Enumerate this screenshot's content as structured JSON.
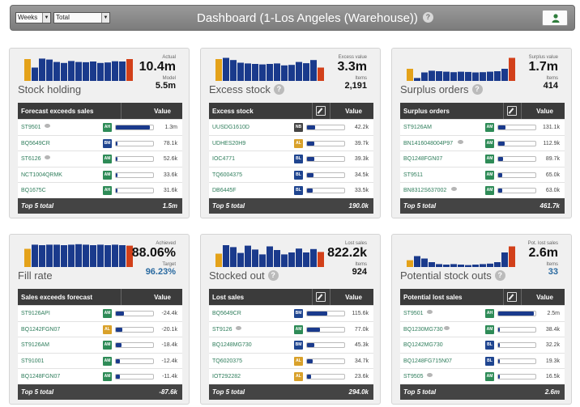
{
  "header": {
    "period_select": "Weeks",
    "scope_select": "Total",
    "title": "Dashboard (1-Los Angeles (Warehouse))",
    "help_icon": "question-icon",
    "user_icon": "user-icon"
  },
  "colors": {
    "bar_blue": "#1a3a8c",
    "bar_orange": "#e4a21a",
    "bar_red": "#d2401a",
    "badge_green": "#2e8b57",
    "badge_blue": "#1f4590",
    "badge_orange": "#d9a12a",
    "badge_dark": "#444444"
  },
  "panels": [
    {
      "id": "stock-holding",
      "name": "Stock holding",
      "has_help": false,
      "kpi_label": "Actual",
      "kpi_value": "10.4m",
      "sub_label": "Model",
      "sub_value": "5.5m",
      "sub_blue": false,
      "show_edit": false,
      "spark": {
        "orange": 0.9,
        "red": 0.9,
        "blue": [
          0.55,
          0.92,
          0.88,
          0.78,
          0.74,
          0.82,
          0.78,
          0.77,
          0.8,
          0.74,
          0.76,
          0.81,
          0.8
        ]
      },
      "table": {
        "col1": "Forecast exceeds sales",
        "col2": "Value",
        "rows": [
          {
            "name": "ST9501",
            "comment": true,
            "badge": "AH",
            "color": "green",
            "fill": 0.92,
            "value": "1.3m"
          },
          {
            "name": "BQ5649CR",
            "comment": false,
            "badge": "BM",
            "color": "blue",
            "fill": 0.05,
            "value": "78.1k"
          },
          {
            "name": "ST6126",
            "comment": true,
            "badge": "AM",
            "color": "green",
            "fill": 0.04,
            "value": "52.6k"
          },
          {
            "name": "NCT1004QRMK",
            "comment": false,
            "badge": "AM",
            "color": "green",
            "fill": 0.025,
            "value": "33.6k"
          },
          {
            "name": "BQ1675C",
            "comment": false,
            "badge": "AH",
            "color": "green",
            "fill": 0.02,
            "value": "31.6k"
          }
        ],
        "total_label": "Top 5 total",
        "total_value": "1.5m"
      }
    },
    {
      "id": "excess-stock",
      "name": "Excess stock",
      "has_help": true,
      "kpi_label": "Excess value",
      "kpi_value": "3.3m",
      "sub_label": "Items",
      "sub_value": "2,191",
      "sub_blue": false,
      "show_edit": true,
      "spark": {
        "orange": 0.9,
        "red": 0.55,
        "blue": [
          0.95,
          0.86,
          0.75,
          0.72,
          0.7,
          0.68,
          0.7,
          0.72,
          0.64,
          0.66,
          0.78,
          0.73,
          0.86
        ]
      },
      "table": {
        "col1": "Excess stock",
        "col2": "Value",
        "rows": [
          {
            "name": "UUSDG1610D",
            "comment": false,
            "badge": "NB",
            "color": "dark",
            "fill": 0.22,
            "value": "42.2k"
          },
          {
            "name": "UDHES20H9",
            "comment": false,
            "badge": "AL",
            "color": "orange",
            "fill": 0.2,
            "value": "39.7k"
          },
          {
            "name": "IOC4771",
            "comment": false,
            "badge": "BL",
            "color": "blue",
            "fill": 0.2,
            "value": "39.3k"
          },
          {
            "name": "TQ6004375",
            "comment": false,
            "badge": "BL",
            "color": "blue",
            "fill": 0.17,
            "value": "34.5k"
          },
          {
            "name": "DB6445F",
            "comment": false,
            "badge": "BL",
            "color": "blue",
            "fill": 0.16,
            "value": "33.5k"
          }
        ],
        "total_label": "Top 5 total",
        "total_value": "190.0k"
      }
    },
    {
      "id": "surplus-orders",
      "name": "Surplus orders",
      "has_help": true,
      "kpi_label": "Surplus value",
      "kpi_value": "1.7m",
      "sub_label": "Items",
      "sub_value": "414",
      "sub_blue": false,
      "show_edit": true,
      "spark": {
        "orange": 0.5,
        "red": 0.95,
        "blue": [
          0.12,
          0.35,
          0.42,
          0.4,
          0.38,
          0.36,
          0.38,
          0.37,
          0.35,
          0.36,
          0.38,
          0.4,
          0.5
        ]
      },
      "table": {
        "col1": "Surplus orders",
        "col2": "Value",
        "rows": [
          {
            "name": "ST9126AM",
            "comment": false,
            "badge": "AM",
            "color": "green",
            "fill": 0.2,
            "value": "131.1k"
          },
          {
            "name": "BN1416048004P97",
            "comment": true,
            "badge": "AM",
            "color": "green",
            "fill": 0.18,
            "value": "112.9k"
          },
          {
            "name": "BQ1248FGN07",
            "comment": false,
            "badge": "AM",
            "color": "green",
            "fill": 0.14,
            "value": "89.7k"
          },
          {
            "name": "ST9511",
            "comment": false,
            "badge": "AM",
            "color": "green",
            "fill": 0.1,
            "value": "65.0k"
          },
          {
            "name": "BN8312S637002",
            "comment": true,
            "badge": "AM",
            "color": "green",
            "fill": 0.1,
            "value": "63.0k"
          }
        ],
        "total_label": "Top 5 total",
        "total_value": "461.7k"
      }
    },
    {
      "id": "fill-rate",
      "name": "Fill rate",
      "has_help": false,
      "kpi_label": "Achieved",
      "kpi_value": "88.06%",
      "sub_label": "Target",
      "sub_value": "96.23%",
      "sub_blue": true,
      "show_edit": false,
      "spark": {
        "orange": 0.75,
        "red": 0.88,
        "blue": [
          0.92,
          0.9,
          0.92,
          0.92,
          0.9,
          0.92,
          0.94,
          0.92,
          0.9,
          0.92,
          0.9,
          0.92,
          0.9
        ]
      },
      "table": {
        "col1": "Sales exceeds forecast",
        "col2": "Value",
        "rows": [
          {
            "name": "ST9126API",
            "comment": false,
            "badge": "AM",
            "color": "green",
            "fill": 0.22,
            "value": "-24.4k"
          },
          {
            "name": "BQ1242FGN07",
            "comment": false,
            "badge": "AL",
            "color": "orange",
            "fill": 0.18,
            "value": "-20.1k"
          },
          {
            "name": "ST9126AM",
            "comment": false,
            "badge": "AM",
            "color": "green",
            "fill": 0.16,
            "value": "-18.4k"
          },
          {
            "name": "ST91001",
            "comment": false,
            "badge": "AM",
            "color": "green",
            "fill": 0.1,
            "value": "-12.4k"
          },
          {
            "name": "BQ1248FGN07",
            "comment": false,
            "badge": "AM",
            "color": "green",
            "fill": 0.1,
            "value": "-11.4k"
          }
        ],
        "total_label": "Top 5 total",
        "total_value": "-87.6k"
      }
    },
    {
      "id": "stocked-out",
      "name": "Stocked out",
      "has_help": true,
      "kpi_label": "Lost sales",
      "kpi_value": "822.2k",
      "sub_label": "Items",
      "sub_value": "924",
      "sub_blue": false,
      "show_edit": true,
      "spark": {
        "orange": 0.55,
        "red": 0.62,
        "blue": [
          0.9,
          0.82,
          0.58,
          0.88,
          0.72,
          0.52,
          0.85,
          0.7,
          0.52,
          0.6,
          0.76,
          0.6,
          0.74
        ]
      },
      "table": {
        "col1": "Lost sales",
        "col2": "Value",
        "rows": [
          {
            "name": "BQ5649CR",
            "comment": false,
            "badge": "BM",
            "color": "blue",
            "fill": 0.55,
            "value": "115.6k"
          },
          {
            "name": "ST9126",
            "comment": true,
            "badge": "AM",
            "color": "green",
            "fill": 0.34,
            "value": "77.0k"
          },
          {
            "name": "BQ1248MG730",
            "comment": false,
            "badge": "BM",
            "color": "blue",
            "fill": 0.2,
            "value": "45.3k"
          },
          {
            "name": "TQ6020375",
            "comment": false,
            "badge": "AL",
            "color": "orange",
            "fill": 0.15,
            "value": "34.7k"
          },
          {
            "name": "IOT292282",
            "comment": false,
            "badge": "AL",
            "color": "orange",
            "fill": 0.1,
            "value": "23.6k"
          }
        ],
        "total_label": "Top 5 total",
        "total_value": "294.0k"
      }
    },
    {
      "id": "potential-stock-outs",
      "name": "Potential stock outs",
      "has_help": true,
      "kpi_label": "Pot. lost sales",
      "kpi_value": "2.6m",
      "sub_label": "Items",
      "sub_value": "33",
      "sub_blue": true,
      "show_edit": true,
      "spark": {
        "orange": 0.28,
        "red": 0.85,
        "blue": [
          0.45,
          0.35,
          0.2,
          0.12,
          0.1,
          0.12,
          0.1,
          0.08,
          0.1,
          0.12,
          0.14,
          0.2,
          0.6
        ]
      },
      "table": {
        "col1": "Potential lost sales",
        "col2": "Value",
        "rows": [
          {
            "name": "ST9501",
            "comment": true,
            "badge": "AH",
            "color": "green",
            "fill": 0.95,
            "value": "2.5m"
          },
          {
            "name": "BQ1230MG730",
            "comment": true,
            "badge": "AM",
            "color": "green",
            "fill": 0.02,
            "value": "38.4k"
          },
          {
            "name": "BQ1242MG730",
            "comment": false,
            "badge": "BL",
            "color": "blue",
            "fill": 0.02,
            "value": "32.2k"
          },
          {
            "name": "BQ1248FG715N07",
            "comment": false,
            "badge": "BL",
            "color": "blue",
            "fill": 0.015,
            "value": "19.3k"
          },
          {
            "name": "ST9505",
            "comment": true,
            "badge": "AM",
            "color": "green",
            "fill": 0.015,
            "value": "16.5k"
          }
        ],
        "total_label": "Top 5 total",
        "total_value": "2.6m"
      }
    }
  ]
}
